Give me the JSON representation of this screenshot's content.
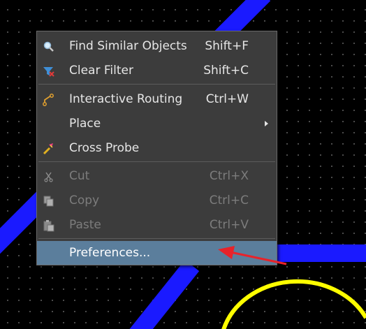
{
  "colors": {
    "track": "#1a1aff",
    "arc": "#ffff00",
    "menu_bg": "#3c3c3c",
    "selected_bg": "#5b7e9c",
    "annotation_arrow": "#e8232a"
  },
  "menu": {
    "items": [
      {
        "icon": "search-icon",
        "label": "Find Similar Objects",
        "shortcut": "Shift+F"
      },
      {
        "icon": "clear-filter-icon",
        "label": "Clear Filter",
        "shortcut": "Shift+C"
      },
      {
        "icon": "interactive-routing-icon",
        "label": "Interactive Routing",
        "shortcut": "Ctrl+W"
      },
      {
        "icon": "",
        "label": "Place",
        "shortcut": "",
        "submenu": true
      },
      {
        "icon": "cross-probe-icon",
        "label": "Cross Probe",
        "shortcut": ""
      },
      {
        "icon": "cut-icon",
        "label": "Cut",
        "shortcut": "Ctrl+X",
        "disabled": true
      },
      {
        "icon": "copy-icon",
        "label": "Copy",
        "shortcut": "Ctrl+C",
        "disabled": true
      },
      {
        "icon": "paste-icon",
        "label": "Paste",
        "shortcut": "Ctrl+V",
        "disabled": true
      },
      {
        "icon": "",
        "label": "Preferences...",
        "shortcut": "",
        "selected": true
      }
    ]
  }
}
